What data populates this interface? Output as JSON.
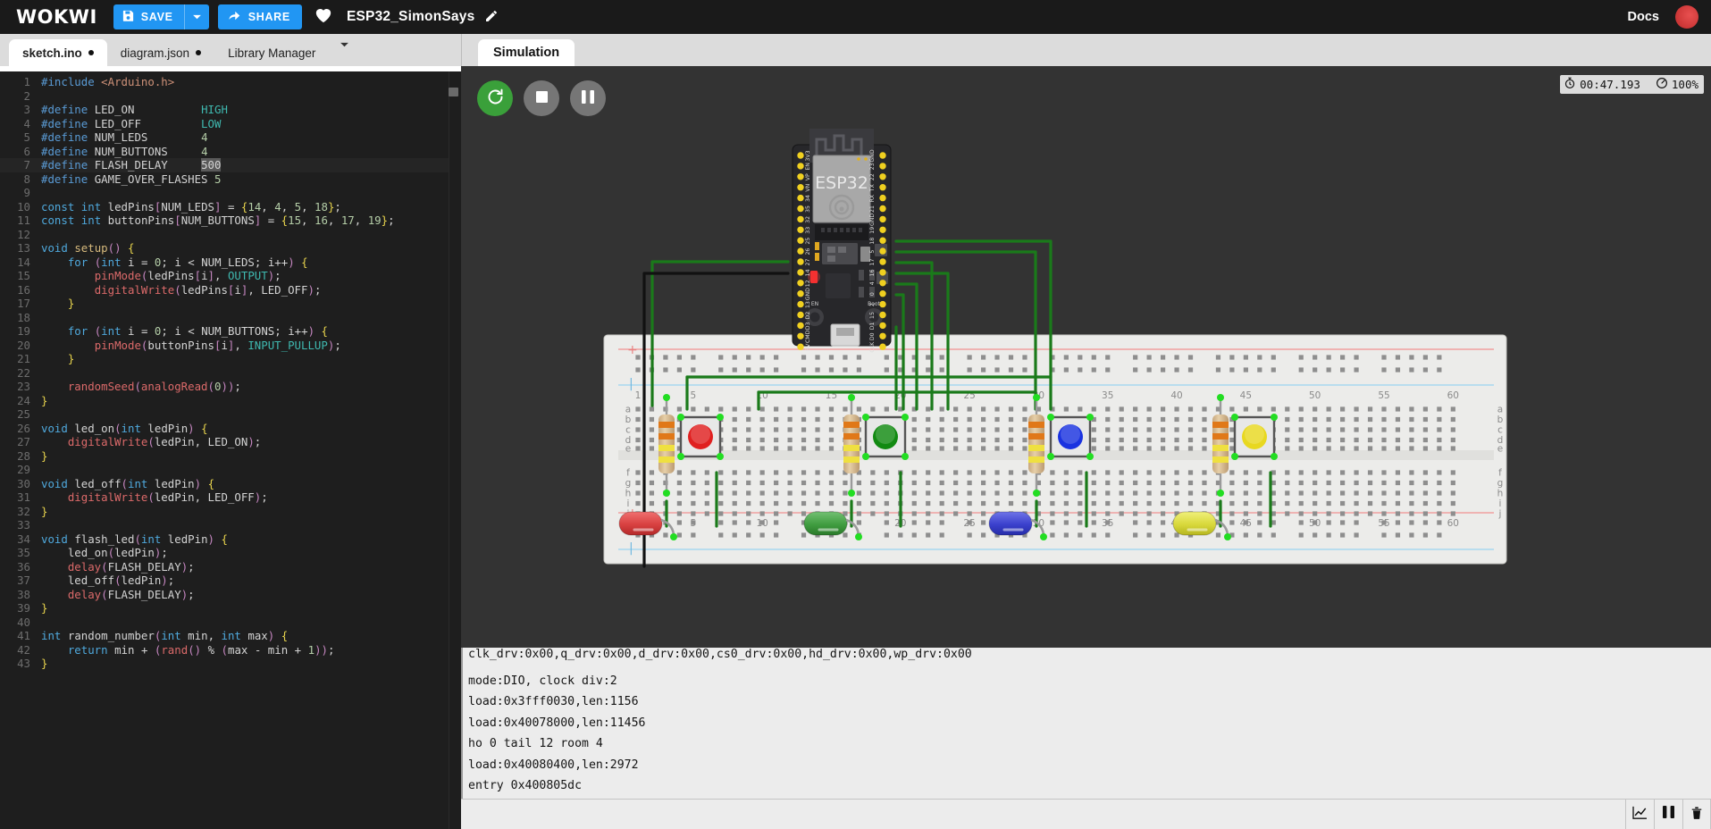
{
  "app": {
    "logo": "WOKWI",
    "save_label": "SAVE",
    "share_label": "SHARE",
    "project_title": "ESP32_SimonSays",
    "docs_label": "Docs",
    "icons": {
      "save": "floppy-disk-icon",
      "save_caret": "chevron-down-icon",
      "share": "share-arrow-icon",
      "favorite": "heart-icon",
      "edit_title": "pencil-icon",
      "avatar": "user-avatar"
    }
  },
  "editor": {
    "tabs": [
      {
        "label": "sketch.ino",
        "modified": true,
        "active": true
      },
      {
        "label": "diagram.json",
        "modified": true,
        "active": false
      },
      {
        "label": "Library Manager",
        "modified": false,
        "active": false
      }
    ],
    "tab_overflow_icon": "chevron-down-icon",
    "highlighted_line": 7,
    "selection_text": "500",
    "lines": [
      {
        "n": 1,
        "text": "#include <Arduino.h>"
      },
      {
        "n": 2,
        "text": ""
      },
      {
        "n": 3,
        "text": "#define LED_ON          HIGH"
      },
      {
        "n": 4,
        "text": "#define LED_OFF         LOW"
      },
      {
        "n": 5,
        "text": "#define NUM_LEDS        4"
      },
      {
        "n": 6,
        "text": "#define NUM_BUTTONS     4"
      },
      {
        "n": 7,
        "text": "#define FLASH_DELAY     500"
      },
      {
        "n": 8,
        "text": "#define GAME_OVER_FLASHES 5"
      },
      {
        "n": 9,
        "text": ""
      },
      {
        "n": 10,
        "text": "const int ledPins[NUM_LEDS] = {14, 4, 5, 18};"
      },
      {
        "n": 11,
        "text": "const int buttonPins[NUM_BUTTONS] = {15, 16, 17, 19};"
      },
      {
        "n": 12,
        "text": ""
      },
      {
        "n": 13,
        "text": "void setup() {"
      },
      {
        "n": 14,
        "text": "    for (int i = 0; i < NUM_LEDS; i++) {"
      },
      {
        "n": 15,
        "text": "        pinMode(ledPins[i], OUTPUT);"
      },
      {
        "n": 16,
        "text": "        digitalWrite(ledPins[i], LED_OFF);"
      },
      {
        "n": 17,
        "text": "    }"
      },
      {
        "n": 18,
        "text": ""
      },
      {
        "n": 19,
        "text": "    for (int i = 0; i < NUM_BUTTONS; i++) {"
      },
      {
        "n": 20,
        "text": "        pinMode(buttonPins[i], INPUT_PULLUP);"
      },
      {
        "n": 21,
        "text": "    }"
      },
      {
        "n": 22,
        "text": ""
      },
      {
        "n": 23,
        "text": "    randomSeed(analogRead(0));"
      },
      {
        "n": 24,
        "text": "}"
      },
      {
        "n": 25,
        "text": ""
      },
      {
        "n": 26,
        "text": "void led_on(int ledPin) {"
      },
      {
        "n": 27,
        "text": "    digitalWrite(ledPin, LED_ON);"
      },
      {
        "n": 28,
        "text": "}"
      },
      {
        "n": 29,
        "text": ""
      },
      {
        "n": 30,
        "text": "void led_off(int ledPin) {"
      },
      {
        "n": 31,
        "text": "    digitalWrite(ledPin, LED_OFF);"
      },
      {
        "n": 32,
        "text": "}"
      },
      {
        "n": 33,
        "text": ""
      },
      {
        "n": 34,
        "text": "void flash_led(int ledPin) {"
      },
      {
        "n": 35,
        "text": "    led_on(ledPin);"
      },
      {
        "n": 36,
        "text": "    delay(FLASH_DELAY);"
      },
      {
        "n": 37,
        "text": "    led_off(ledPin);"
      },
      {
        "n": 38,
        "text": "    delay(FLASH_DELAY);"
      },
      {
        "n": 39,
        "text": "}"
      },
      {
        "n": 40,
        "text": ""
      },
      {
        "n": 41,
        "text": "int random_number(int min, int max) {"
      },
      {
        "n": 42,
        "text": "    return min + (rand() % (max - min + 1));"
      },
      {
        "n": 43,
        "text": "}"
      }
    ]
  },
  "simulation": {
    "tab_label": "Simulation",
    "controls": [
      {
        "name": "restart-button",
        "icon": "restart-icon",
        "color": "#3aa03a"
      },
      {
        "name": "stop-button",
        "icon": "stop-icon",
        "color": "#767676"
      },
      {
        "name": "pause-button",
        "icon": "pause-icon",
        "color": "#767676"
      }
    ],
    "status": {
      "clock_icon": "stopwatch-icon",
      "elapsed": "00:47.193",
      "speed_icon": "gauge-icon",
      "speed": "100%"
    },
    "board": {
      "label": "ESP32",
      "left_pins": [
        "3V3",
        "EN",
        "VP",
        "VN",
        "34",
        "35",
        "32",
        "33",
        "25",
        "26",
        "27",
        "14",
        "12",
        "GND",
        "13",
        "D2",
        "D3",
        "CMD",
        "5V"
      ],
      "right_pins": [
        "GND",
        "23",
        "22",
        "TX",
        "RX",
        "21",
        "GND",
        "19",
        "18",
        "5",
        "17",
        "16",
        "4",
        "0",
        "2",
        "15",
        "D1",
        "D0",
        "CLK"
      ],
      "labels": {
        "en": "EN",
        "boot": "Boot"
      }
    },
    "breadboard": {
      "column_labels": [
        "1",
        "5",
        "10",
        "15",
        "20",
        "25",
        "30",
        "35",
        "40",
        "45",
        "50",
        "55",
        "60"
      ],
      "row_labels_top": [
        "a",
        "b",
        "c",
        "d",
        "e"
      ],
      "row_labels_bottom": [
        "f",
        "g",
        "h",
        "i",
        "j"
      ],
      "rail_plus": "+",
      "rail_minus": "|"
    },
    "components": [
      {
        "type": "pushbutton",
        "color": "#e02020",
        "led_pin": "14",
        "button_pin": "15"
      },
      {
        "type": "pushbutton",
        "color": "#128a12",
        "led_pin": "4",
        "button_pin": "16"
      },
      {
        "type": "pushbutton",
        "color": "#1a32e0",
        "led_pin": "5",
        "button_pin": "17"
      },
      {
        "type": "pushbutton",
        "color": "#e8d820",
        "led_pin": "18",
        "button_pin": "19"
      }
    ],
    "leds": [
      {
        "color": "#d84040"
      },
      {
        "color": "#3f9c3f"
      },
      {
        "color": "#3a40cc"
      },
      {
        "color": "#d8d83a"
      }
    ]
  },
  "serial": {
    "lines": [
      "clk_drv:0x00,q_drv:0x00,d_drv:0x00,cs0_drv:0x00,hd_drv:0x00,wp_drv:0x00",
      "mode:DIO, clock div:2",
      "load:0x3fff0030,len:1156",
      "load:0x40078000,len:11456",
      "ho 0 tail 12 room 4",
      "load:0x40080400,len:2972",
      "entry 0x400805dc"
    ],
    "toolbar": [
      {
        "name": "plotter-button",
        "icon": "chart-line-icon"
      },
      {
        "name": "pause-serial-button",
        "icon": "pause-icon"
      },
      {
        "name": "clear-serial-button",
        "icon": "trash-icon"
      }
    ]
  }
}
